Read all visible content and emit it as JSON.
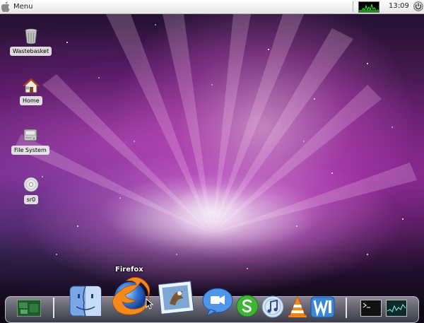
{
  "top_panel": {
    "menu_label": "Menu",
    "clock": "13:09"
  },
  "desktop_icons": [
    {
      "label": "Wastebasket",
      "icon": "wastebasket-icon"
    },
    {
      "label": "Home",
      "icon": "home-icon"
    },
    {
      "label": "File System",
      "icon": "file-system-icon"
    },
    {
      "label": "sr0",
      "icon": "cd-drive-icon"
    }
  ],
  "dock": {
    "tooltip": "Firefox",
    "items": [
      "desktop-preview-icon",
      "finder-icon",
      "firefox-icon",
      "mail-icon",
      "ichat-icon",
      "skype-icon",
      "itunes-icon",
      "vlc-icon",
      "writer-icon",
      "terminal-icon",
      "system-monitor-icon"
    ]
  },
  "colors": {
    "wallpaper_core": "#ffd8f4",
    "wallpaper_mid": "#a43fb0",
    "wallpaper_edge": "#120b1c",
    "panel_bg": "#f0f0f0",
    "label_bg": "#ececec"
  }
}
